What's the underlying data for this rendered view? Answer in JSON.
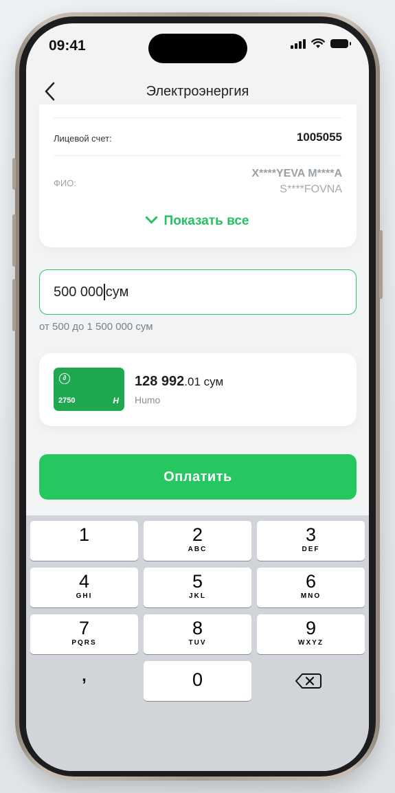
{
  "status_bar": {
    "time": "09:41"
  },
  "nav": {
    "title": "Электроэнергия"
  },
  "account": {
    "account_label": "Лицевой счет:",
    "account_value": "1005055",
    "name_label": "ФИО:",
    "name_line1": "X****YEVA M****A",
    "name_line2": "S****FOVNA",
    "show_all": "Показать все"
  },
  "amount": {
    "value_before_caret": "500 000",
    "value_after_caret": "сум",
    "hint": "от 500 до 1 500 000 сум"
  },
  "card": {
    "number": "2750",
    "balance_whole": "128 992",
    "balance_fraction": ".01 сум",
    "type": "Humo"
  },
  "pay_button": {
    "label": "Оплатить"
  },
  "keyboard": {
    "keys": [
      {
        "digit": "1",
        "letters": ""
      },
      {
        "digit": "2",
        "letters": "ABC"
      },
      {
        "digit": "3",
        "letters": "DEF"
      },
      {
        "digit": "4",
        "letters": "GHI"
      },
      {
        "digit": "5",
        "letters": "JKL"
      },
      {
        "digit": "6",
        "letters": "MNO"
      },
      {
        "digit": "7",
        "letters": "PQRS"
      },
      {
        "digit": "8",
        "letters": "TUV"
      },
      {
        "digit": "9",
        "letters": "WXYZ"
      }
    ],
    "comma": ",",
    "zero": "0"
  },
  "icons": {
    "back": "chevron-left-icon",
    "show_all": "chevron-down-icon",
    "delete": "backspace-icon",
    "card_logo": "humo-logo-icon"
  },
  "colors": {
    "accent": "#26c660",
    "card": "#1fa850"
  }
}
